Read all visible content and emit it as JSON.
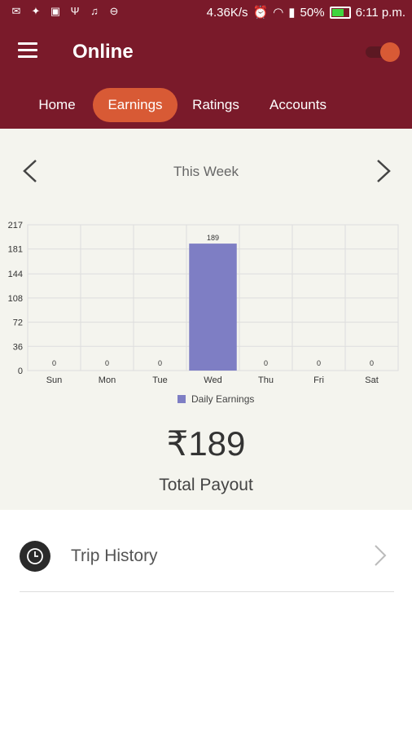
{
  "status_bar": {
    "speed": "4.36K/s",
    "battery": "50%",
    "time": "6:11 p.m.",
    "icons": [
      "email-icon",
      "twitter-icon",
      "image-icon",
      "usb-icon",
      "music-icon",
      "minus-circle-icon",
      "alarm-icon",
      "wifi-icon",
      "signal-icon",
      "battery-icon"
    ]
  },
  "header": {
    "title": "Online",
    "toggle_on": true
  },
  "tabs": [
    {
      "label": "Home"
    },
    {
      "label": "Earnings",
      "active": true
    },
    {
      "label": "Ratings"
    },
    {
      "label": "Accounts"
    }
  ],
  "period_label": "This Week",
  "total": "₹189",
  "total_label": "Total Payout",
  "trip_history_label": "Trip History",
  "colors": {
    "primary": "#7a1a2a",
    "accent": "#d85a35",
    "bar": "#7e7ec4"
  },
  "chart_data": {
    "type": "bar",
    "categories": [
      "Sun",
      "Mon",
      "Tue",
      "Wed",
      "Thu",
      "Fri",
      "Sat"
    ],
    "series": [
      {
        "name": "Daily Earnings",
        "values": [
          0,
          0,
          0,
          189,
          0,
          0,
          0
        ]
      }
    ],
    "yticks": [
      0,
      36,
      72,
      108,
      144,
      181,
      217
    ],
    "ylim": [
      0,
      217
    ],
    "grid": true,
    "legend": "bottom"
  }
}
